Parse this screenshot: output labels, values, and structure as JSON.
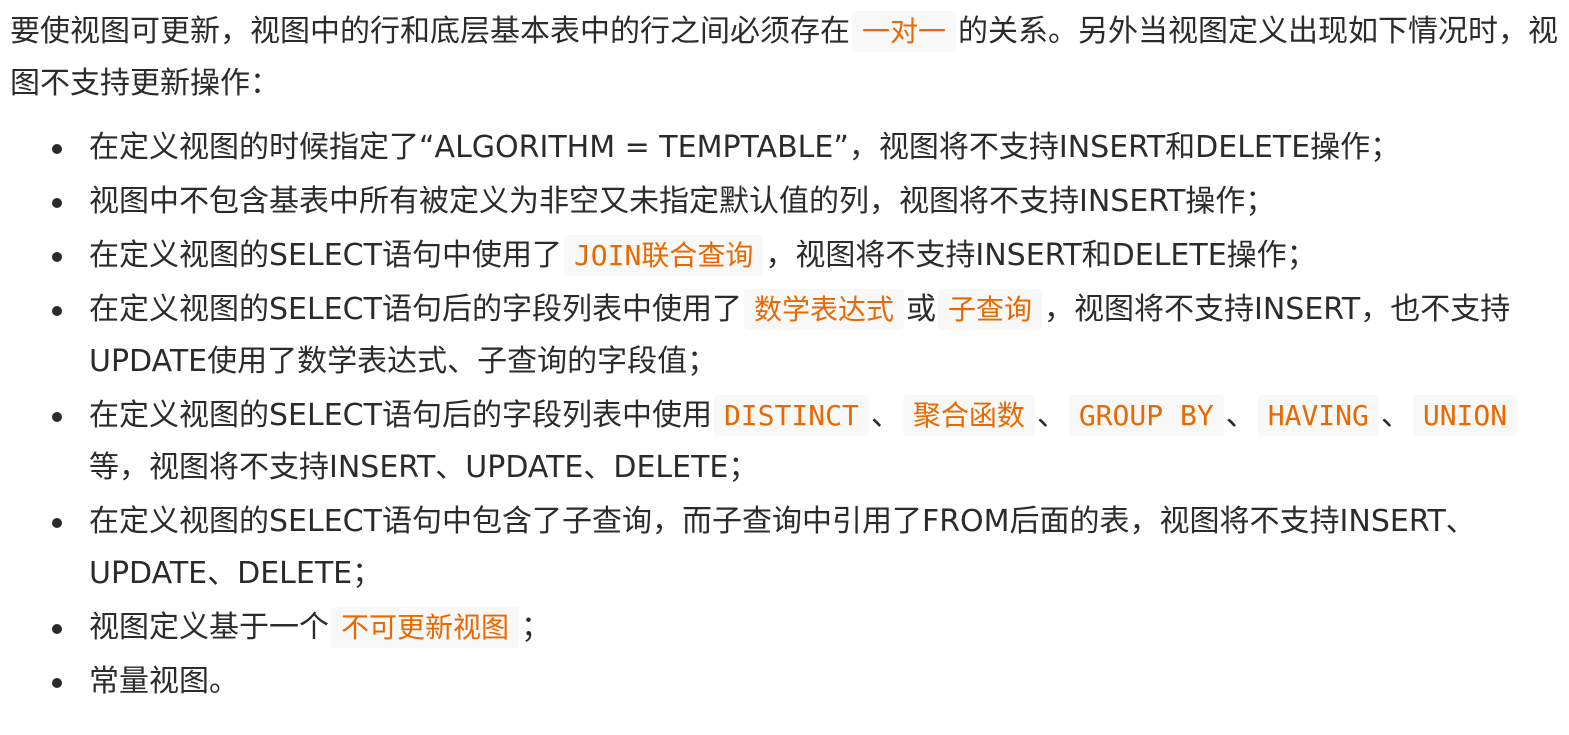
{
  "intro": {
    "text_before": "要使视图可更新，视图中的行和底层基本表中的行之间必须存在",
    "code": "一对一",
    "text_after": "的关系。另外当视图定义出现如下情况时，视图不支持更新操作："
  },
  "items": [
    {
      "segments": [
        {
          "type": "text",
          "value": "在定义视图的时候指定了“ALGORITHM = TEMPTABLE”，视图将不支持INSERT和DELETE操作；"
        }
      ]
    },
    {
      "segments": [
        {
          "type": "text",
          "value": "视图中不包含基表中所有被定义为非空又未指定默认值的列，视图将不支持INSERT操作；"
        }
      ]
    },
    {
      "segments": [
        {
          "type": "text",
          "value": "在定义视图的SELECT语句中使用了"
        },
        {
          "type": "code",
          "value": "JOIN联合查询"
        },
        {
          "type": "text",
          "value": "，视图将不支持INSERT和DELETE操作；"
        }
      ]
    },
    {
      "segments": [
        {
          "type": "text",
          "value": "在定义视图的SELECT语句后的字段列表中使用了"
        },
        {
          "type": "code",
          "value": "数学表达式"
        },
        {
          "type": "text",
          "value": "或"
        },
        {
          "type": "code",
          "value": "子查询"
        },
        {
          "type": "text",
          "value": "，视图将不支持INSERT，也不支持UPDATE使用了数学表达式、子查询的字段值；"
        }
      ]
    },
    {
      "segments": [
        {
          "type": "text",
          "value": "在定义视图的SELECT语句后的字段列表中使用"
        },
        {
          "type": "code",
          "value": "DISTINCT"
        },
        {
          "type": "text",
          "value": "、"
        },
        {
          "type": "code",
          "value": "聚合函数"
        },
        {
          "type": "text",
          "value": "、"
        },
        {
          "type": "code",
          "value": "GROUP BY"
        },
        {
          "type": "text",
          "value": "、"
        },
        {
          "type": "code",
          "value": "HAVING"
        },
        {
          "type": "text",
          "value": "、"
        },
        {
          "type": "code",
          "value": "UNION"
        },
        {
          "type": "text",
          "value": "等，视图将不支持INSERT、UPDATE、DELETE；"
        }
      ]
    },
    {
      "segments": [
        {
          "type": "text",
          "value": "在定义视图的SELECT语句中包含了子查询，而子查询中引用了FROM后面的表，视图将不支持INSERT、UPDATE、DELETE；"
        }
      ]
    },
    {
      "segments": [
        {
          "type": "text",
          "value": "视图定义基于一个"
        },
        {
          "type": "code",
          "value": "不可更新视图"
        },
        {
          "type": "text",
          "value": "；"
        }
      ]
    },
    {
      "segments": [
        {
          "type": "text",
          "value": "常量视图。"
        }
      ]
    }
  ],
  "colors": {
    "text": "#2b2b2b",
    "code_text": "#e96900",
    "code_background": "#f8f8f8",
    "page_background": "#ffffff"
  }
}
